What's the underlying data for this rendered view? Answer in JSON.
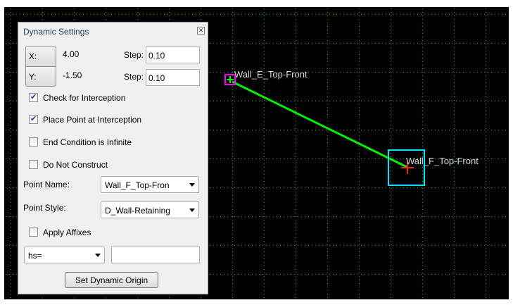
{
  "canvas": {
    "background": "#000000",
    "grid_color": "#00c000",
    "line_color": "#00ee00",
    "point_e": {
      "label": "Wall_E_Top-Front",
      "marker_color": "#ff00ff",
      "cross_color": "#00ff00"
    },
    "point_f": {
      "label": "Wall_F_Top-Front",
      "box_color": "#00e5ff",
      "cross_color": "#ff2020"
    }
  },
  "dialog": {
    "title": "Dynamic Settings",
    "close_icon": "close-icon",
    "x_button": "X:",
    "x_value": "4.00",
    "y_button": "Y:",
    "y_value": "-1.50",
    "step_label_x": "Step:",
    "step_value_x": "0.10",
    "step_label_y": "Step:",
    "step_value_y": "0.10",
    "checkboxes": [
      {
        "label": "Check for Interception",
        "checked": true
      },
      {
        "label": "Place Point at Interception",
        "checked": true
      },
      {
        "label": "End Condition is Infinite",
        "checked": false
      },
      {
        "label": "Do Not Construct",
        "checked": false
      }
    ],
    "point_name_label": "Point Name:",
    "point_name_value": "Wall_F_Top-Fron",
    "point_style_label": "Point Style:",
    "point_style_value": "D_Wall-Retaining",
    "apply_affixes": {
      "label": "Apply Affixes",
      "checked": false
    },
    "affix_select_value": "hs=",
    "affix_text_value": "",
    "set_origin_button": "Set Dynamic Origin"
  }
}
